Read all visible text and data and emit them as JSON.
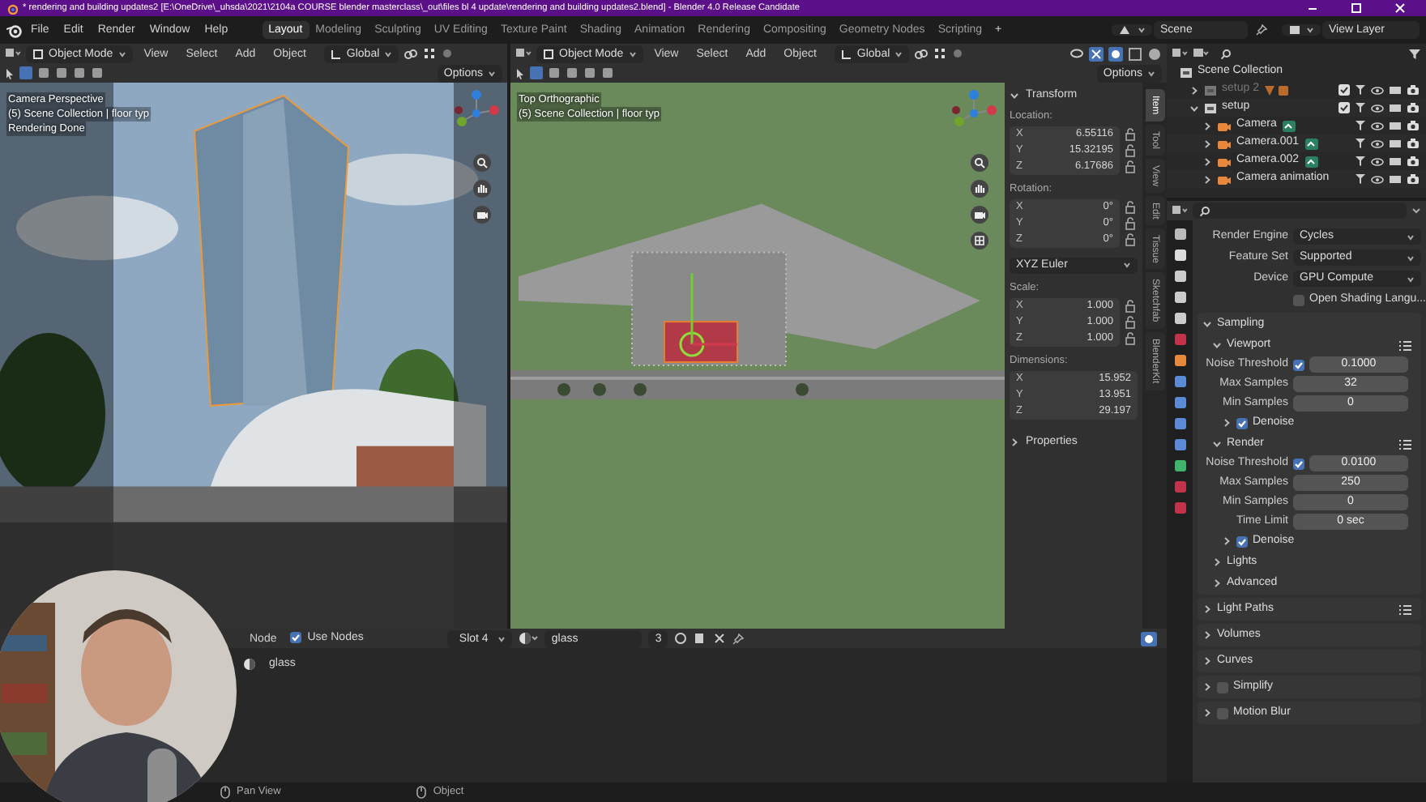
{
  "window": {
    "title": "* rendering and building updates2 [E:\\OneDrive\\_uhsda\\2021\\2104a COURSE blender masterclass\\_out\\files bl 4 update\\rendering and building updates2.blend] - Blender 4.0 Release Candidate",
    "controls": [
      {
        "kind": "minimize"
      },
      {
        "kind": "maximize"
      },
      {
        "kind": "close"
      }
    ]
  },
  "menu": [
    "File",
    "Edit",
    "Render",
    "Window",
    "Help"
  ],
  "workspaces": [
    {
      "label": "Layout",
      "selected": true
    },
    {
      "label": "Modeling",
      "selected": false
    },
    {
      "label": "Sculpting",
      "selected": false
    },
    {
      "label": "UV Editing",
      "selected": false
    },
    {
      "label": "Texture Paint",
      "selected": false
    },
    {
      "label": "Shading",
      "selected": false
    },
    {
      "label": "Animation",
      "selected": false
    },
    {
      "label": "Rendering",
      "selected": false
    },
    {
      "label": "Compositing",
      "selected": false
    },
    {
      "label": "Geometry Nodes",
      "selected": false
    },
    {
      "label": "Scripting",
      "selected": false
    }
  ],
  "add_workspace": "+",
  "scene": "Scene",
  "view_layer": "View Layer",
  "viewports": [
    {
      "kind": "camera",
      "mode": "Object Mode",
      "menus": [
        "View",
        "Select",
        "Add",
        "Object"
      ],
      "orientation": "Global",
      "options": "Options",
      "overlay": [
        "Camera Perspective",
        "(5) Scene Collection | floor typ",
        "Rendering Done"
      ]
    },
    {
      "kind": "top",
      "mode": "Object Mode",
      "menus": [
        "View",
        "Select",
        "Add",
        "Object"
      ],
      "orientation": "Global",
      "options": "Options",
      "overlay": [
        "Top Orthographic",
        "(5) Scene Collection | floor typ"
      ]
    }
  ],
  "sidebar": {
    "panel": "Transform",
    "groups": [
      {
        "label": "Location:",
        "locks": true,
        "fields": [
          {
            "axis": "X",
            "value": "6.55116"
          },
          {
            "axis": "Y",
            "value": "15.32195"
          },
          {
            "axis": "Z",
            "value": "6.17686"
          }
        ]
      },
      {
        "label": "Rotation:",
        "locks": true,
        "fields": [
          {
            "axis": "X",
            "value": "0°"
          },
          {
            "axis": "Y",
            "value": "0°"
          },
          {
            "axis": "Z",
            "value": "0°"
          }
        ],
        "mode": "XYZ Euler"
      },
      {
        "label": "Scale:",
        "locks": true,
        "fields": [
          {
            "axis": "X",
            "value": "1.000"
          },
          {
            "axis": "Y",
            "value": "1.000"
          },
          {
            "axis": "Z",
            "value": "1.000"
          }
        ]
      },
      {
        "label": "Dimensions:",
        "locks": false,
        "fields": [
          {
            "axis": "X",
            "value": "15.952"
          },
          {
            "axis": "Y",
            "value": "13.951"
          },
          {
            "axis": "Z",
            "value": "29.197"
          }
        ]
      }
    ],
    "properties": "Properties",
    "tabs": [
      {
        "label": "Item",
        "selected": true
      },
      {
        "label": "Tool",
        "selected": false
      },
      {
        "label": "View",
        "selected": false
      },
      {
        "label": "Edit",
        "selected": false
      },
      {
        "label": "Tissue",
        "selected": false
      },
      {
        "label": "Sketchfab",
        "selected": false
      },
      {
        "label": "BlenderKit",
        "selected": false
      }
    ]
  },
  "outliner": {
    "root": "Scene Collection",
    "children": [
      {
        "kind": "collection",
        "label": "setup 2",
        "disabled": true,
        "expanded": false,
        "badge": true
      },
      {
        "kind": "collection",
        "label": "setup",
        "disabled": false,
        "expanded": true,
        "children": [
          {
            "kind": "camera",
            "label": "Camera",
            "badge": true
          },
          {
            "kind": "camera",
            "label": "Camera.001",
            "badge": true
          },
          {
            "kind": "camera",
            "label": "Camera.002",
            "badge": true
          },
          {
            "kind": "camera",
            "label": "Camera animation"
          }
        ]
      }
    ]
  },
  "properties": {
    "fields": [
      {
        "label": "Render Engine",
        "value": "Cycles"
      },
      {
        "label": "Feature Set",
        "value": "Supported"
      },
      {
        "label": "Device",
        "value": "GPU Compute"
      }
    ],
    "osl": {
      "label": "Open Shading Langu...",
      "checked": false
    },
    "panels": [
      {
        "kind": "panel",
        "label": "Sampling",
        "expanded": true,
        "children": [
          {
            "kind": "panel",
            "label": "Viewport",
            "expanded": true,
            "presets": true,
            "children": [
              {
                "kind": "check-number",
                "label": "Noise Threshold",
                "checked": true,
                "value": "0.1000"
              },
              {
                "kind": "number",
                "label": "Max Samples",
                "value": "32"
              },
              {
                "kind": "number",
                "label": "Min Samples",
                "value": "0"
              },
              {
                "kind": "panel",
                "label": "Denoise",
                "expanded": false,
                "checked": true
              }
            ]
          },
          {
            "kind": "panel",
            "label": "Render",
            "expanded": true,
            "presets": true,
            "children": [
              {
                "kind": "check-number",
                "label": "Noise Threshold",
                "checked": true,
                "value": "0.0100"
              },
              {
                "kind": "number",
                "label": "Max Samples",
                "value": "250"
              },
              {
                "kind": "number",
                "label": "Min Samples",
                "value": "0"
              },
              {
                "kind": "number",
                "label": "Time Limit",
                "value": "0 sec"
              },
              {
                "kind": "panel",
                "label": "Denoise",
                "expanded": false,
                "checked": true
              }
            ]
          },
          {
            "kind": "panel",
            "label": "Lights",
            "expanded": false
          },
          {
            "kind": "panel",
            "label": "Advanced",
            "expanded": false
          }
        ]
      },
      {
        "kind": "panel",
        "label": "Light Paths",
        "expanded": false,
        "presets": true
      },
      {
        "kind": "panel",
        "label": "Volumes",
        "expanded": false
      },
      {
        "kind": "panel",
        "label": "Curves",
        "expanded": false
      },
      {
        "kind": "panel",
        "label": "Simplify",
        "expanded": false,
        "checked": false
      },
      {
        "kind": "panel",
        "label": "Motion Blur",
        "expanded": false,
        "checked": false
      }
    ]
  },
  "shader_editor": {
    "node_menu": "Node",
    "use_nodes": {
      "label": "Use Nodes",
      "checked": true
    },
    "slot": "Slot 4",
    "material": "glass",
    "users": "3",
    "materials": [
      {
        "label": "glass"
      }
    ]
  },
  "status_bar": [
    {
      "label": "Pan View"
    },
    {
      "label": "Object"
    }
  ],
  "webcam": {
    "kind": "picture"
  }
}
